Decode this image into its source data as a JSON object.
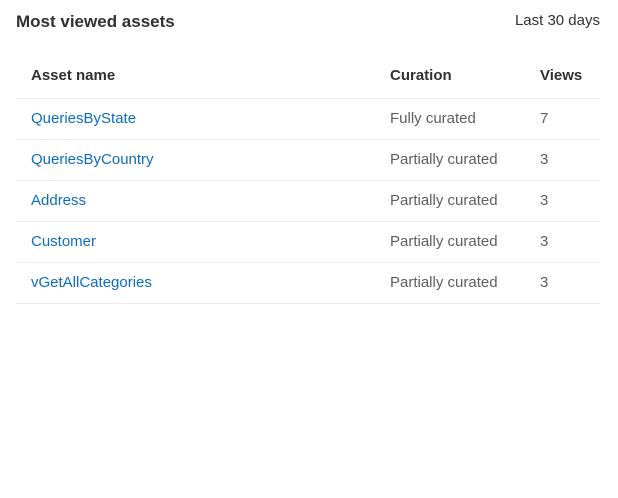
{
  "card": {
    "title": "Most viewed assets",
    "range": "Last 30 days"
  },
  "table": {
    "columns": {
      "name": "Asset name",
      "curation": "Curation",
      "views": "Views"
    },
    "rows": [
      {
        "name": "QueriesByState",
        "curation": "Fully curated",
        "views": "7"
      },
      {
        "name": "QueriesByCountry",
        "curation": "Partially curated",
        "views": "3"
      },
      {
        "name": "Address",
        "curation": "Partially curated",
        "views": "3"
      },
      {
        "name": "Customer",
        "curation": "Partially curated",
        "views": "3"
      },
      {
        "name": "vGetAllCategories",
        "curation": "Partially curated",
        "views": "3"
      }
    ]
  },
  "colors": {
    "link": "#0f6cbd",
    "text": "#323130",
    "muted": "#605e5c",
    "divider": "#edebe9"
  }
}
